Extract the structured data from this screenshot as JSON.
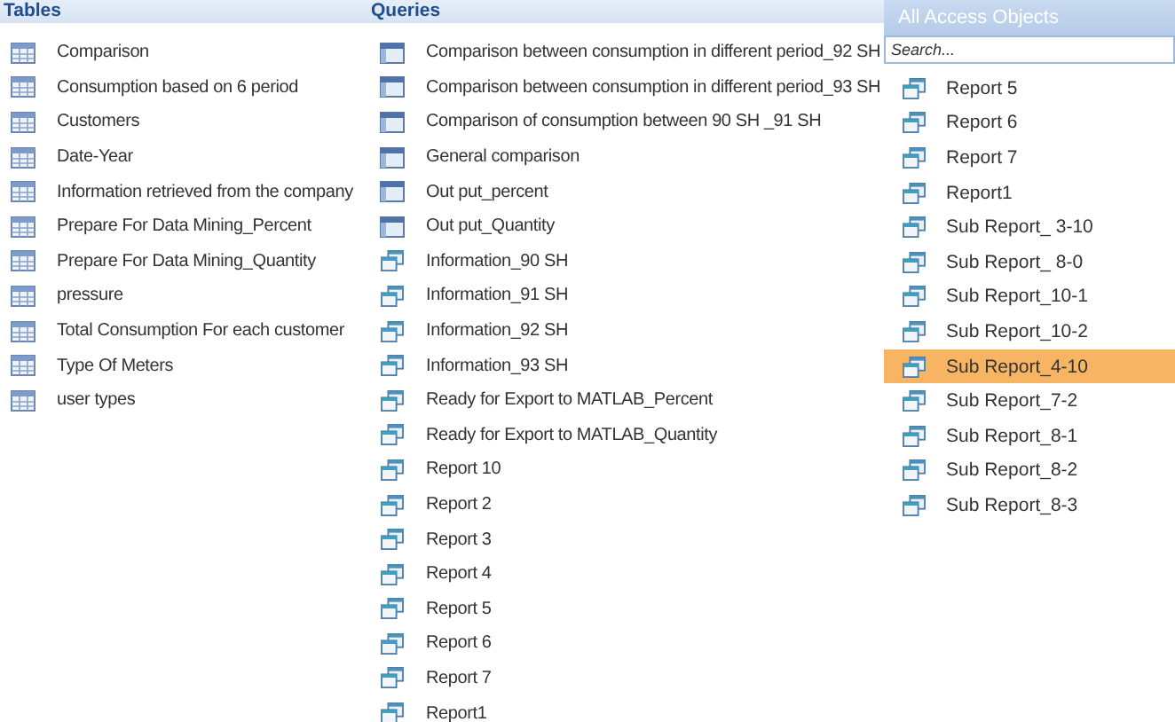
{
  "groups": [
    {
      "title": "Tables",
      "items": [
        {
          "label": "Comparison",
          "kind": "table"
        },
        {
          "label": "Consumption based on 6 period",
          "kind": "table"
        },
        {
          "label": "Customers",
          "kind": "table"
        },
        {
          "label": "Date-Year",
          "kind": "table"
        },
        {
          "label": "Information retrieved from the company",
          "kind": "table"
        },
        {
          "label": "Prepare For Data Mining_Percent",
          "kind": "table"
        },
        {
          "label": "Prepare For Data Mining_Quantity",
          "kind": "table"
        },
        {
          "label": "pressure",
          "kind": "table"
        },
        {
          "label": "Total Consumption For each customer",
          "kind": "table"
        },
        {
          "label": "Type Of Meters",
          "kind": "table"
        },
        {
          "label": "user types",
          "kind": "table"
        }
      ]
    },
    {
      "title": "Queries",
      "items": [
        {
          "label": "Comparison  between consumption in different period_92 SH",
          "kind": "query"
        },
        {
          "label": "Comparison  between consumption in different period_93 SH",
          "kind": "query"
        },
        {
          "label": "Comparison of consumption  between 90 SH _91 SH",
          "kind": "query"
        },
        {
          "label": "General comparison",
          "kind": "query"
        },
        {
          "label": "Out put_percent",
          "kind": "query"
        },
        {
          "label": "Out put_Quantity",
          "kind": "query"
        },
        {
          "label": "Information_90 SH",
          "kind": "report"
        },
        {
          "label": "Information_91 SH",
          "kind": "report"
        },
        {
          "label": "Information_92 SH",
          "kind": "report"
        },
        {
          "label": "Information_93 SH",
          "kind": "report"
        },
        {
          "label": "Ready for Export to MATLAB_Percent",
          "kind": "report"
        },
        {
          "label": "Ready for Export to MATLAB_Quantity",
          "kind": "report"
        },
        {
          "label": "Report 10",
          "kind": "report"
        },
        {
          "label": "Report 2",
          "kind": "report"
        },
        {
          "label": "Report 3",
          "kind": "report"
        },
        {
          "label": "Report 4",
          "kind": "report"
        },
        {
          "label": "Report 5",
          "kind": "report"
        },
        {
          "label": "Report 6",
          "kind": "report"
        },
        {
          "label": "Report 7",
          "kind": "report"
        },
        {
          "label": "Report1",
          "kind": "report"
        }
      ]
    }
  ],
  "panel": {
    "title": "All Access Objects",
    "search": {
      "placeholder": "Search..."
    },
    "items": [
      {
        "label": "Report 5",
        "kind": "report",
        "selected": false
      },
      {
        "label": "Report 6",
        "kind": "report",
        "selected": false
      },
      {
        "label": "Report 7",
        "kind": "report",
        "selected": false
      },
      {
        "label": "Report1",
        "kind": "report",
        "selected": false
      },
      {
        "label": "Sub Report_ 3-10",
        "kind": "report",
        "selected": false
      },
      {
        "label": "Sub Report_ 8-0",
        "kind": "report",
        "selected": false
      },
      {
        "label": "Sub Report_10-1",
        "kind": "report",
        "selected": false
      },
      {
        "label": "Sub Report_10-2",
        "kind": "report",
        "selected": false
      },
      {
        "label": "Sub Report_4-10",
        "kind": "report",
        "selected": true
      },
      {
        "label": "Sub Report_7-2",
        "kind": "report",
        "selected": false
      },
      {
        "label": "Sub Report_8-1",
        "kind": "report",
        "selected": false
      },
      {
        "label": "Sub Report_8-2",
        "kind": "report",
        "selected": false
      },
      {
        "label": "Sub Report_8-3",
        "kind": "report",
        "selected": false
      }
    ]
  }
}
